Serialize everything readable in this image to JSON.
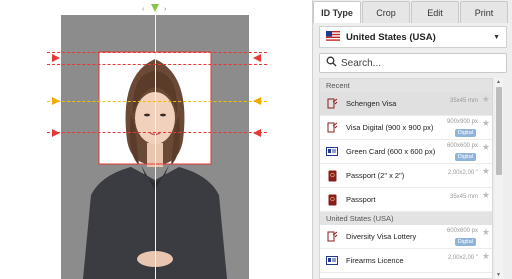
{
  "tabs": [
    {
      "label": "ID Type",
      "active": true
    },
    {
      "label": "Crop",
      "active": false
    },
    {
      "label": "Edit",
      "active": false
    },
    {
      "label": "Print",
      "active": false
    }
  ],
  "country": {
    "label": "United States (USA)",
    "flag_icon": "us-flag-icon",
    "caret_icon": "caret-down-icon"
  },
  "search": {
    "placeholder": "Search...",
    "value": "",
    "icon": "search-icon"
  },
  "sections": [
    {
      "header": "Recent",
      "items": [
        {
          "name": "Schengen Visa",
          "size": "35x45 mm",
          "tag": "",
          "icon": "passport-stamp-icon",
          "selected": true
        },
        {
          "name": "Visa Digital (900 x 900 px)",
          "size": "900x900 px",
          "tag": "Digital",
          "icon": "passport-stamp-icon",
          "selected": false
        },
        {
          "name": "Green Card (600 x 600 px)",
          "size": "600x600 px",
          "tag": "Digital",
          "icon": "id-card-icon",
          "selected": false
        },
        {
          "name": "Passport (2\" x 2\")",
          "size": "2,00x2,00 \"",
          "tag": "",
          "icon": "passport-icon",
          "selected": false
        },
        {
          "name": "Passport",
          "size": "35x45 mm",
          "tag": "",
          "icon": "passport-icon",
          "selected": false
        }
      ]
    },
    {
      "header": "United States (USA)",
      "items": [
        {
          "name": "Diversity Visa Lottery",
          "size": "600x600 px",
          "tag": "Digital",
          "icon": "passport-stamp-icon",
          "selected": false
        },
        {
          "name": "Firearms Licence",
          "size": "2,00x2,00 \"",
          "tag": "",
          "icon": "id-card-icon",
          "selected": false
        }
      ]
    }
  ],
  "colors": {
    "guide_red": "#e53935",
    "guide_yellow": "#f2c000",
    "handle_green": "#8bc34a",
    "canvas_bg": "#8c8c8c"
  }
}
